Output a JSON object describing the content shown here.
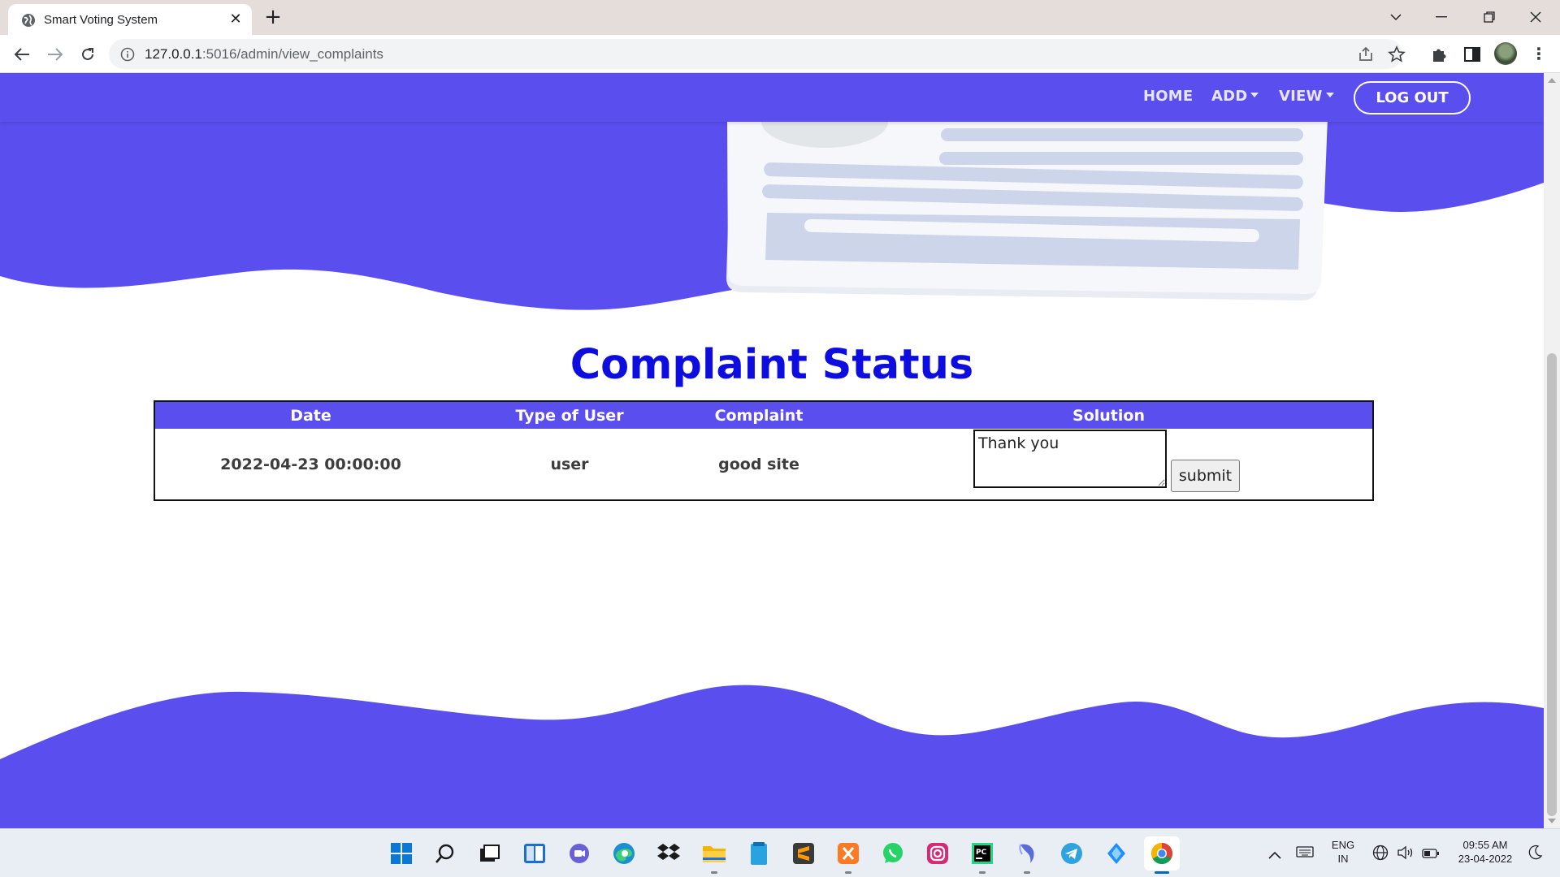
{
  "browser": {
    "tab_title": "Smart Voting System",
    "url_host": "127.0.0.1",
    "url_rest": ":5016/admin/view_complaints"
  },
  "navbar": {
    "home": "HOME",
    "add": "ADD",
    "view": "VIEW",
    "logout": "LOG OUT"
  },
  "page": {
    "title": "Complaint Status"
  },
  "table": {
    "headers": [
      "Date",
      "Type of User",
      "Complaint",
      "Solution"
    ],
    "rows": [
      {
        "date": "2022-04-23 00:00:00",
        "user_type": "user",
        "complaint": "good site",
        "solution_text": "Thank you",
        "submit_label": "submit"
      }
    ]
  },
  "taskbar": {
    "lang_top": "ENG",
    "lang_bottom": "IN",
    "time": "09:55 AM",
    "date": "23-04-2022"
  },
  "colors": {
    "brand": "#5b4eef",
    "title": "#0d0de0"
  }
}
